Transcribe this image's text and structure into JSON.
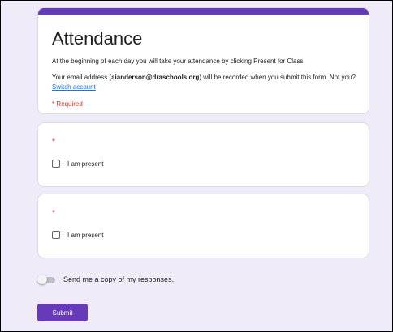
{
  "form": {
    "title": "Attendance",
    "description": "At the beginning of each day you will take your attendance by clicking Present for Class.",
    "email_prefix": "Your email address (",
    "email": "aianderson@draschools.org",
    "email_suffix": ") will be recorded when you submit this form. Not you? ",
    "switch_account": "Switch account",
    "required_note": "* Required"
  },
  "questions": [
    {
      "required_mark": "*",
      "option_label": "I am present",
      "checked": false
    },
    {
      "required_mark": "*",
      "option_label": "I am present",
      "checked": false
    }
  ],
  "copy_toggle": {
    "label": "Send me a copy of my responses.",
    "on": false
  },
  "submit": {
    "label": "Submit"
  },
  "colors": {
    "accent": "#673ab7",
    "background": "#f0ebf8",
    "required": "#d93025",
    "link": "#1a73e8"
  }
}
